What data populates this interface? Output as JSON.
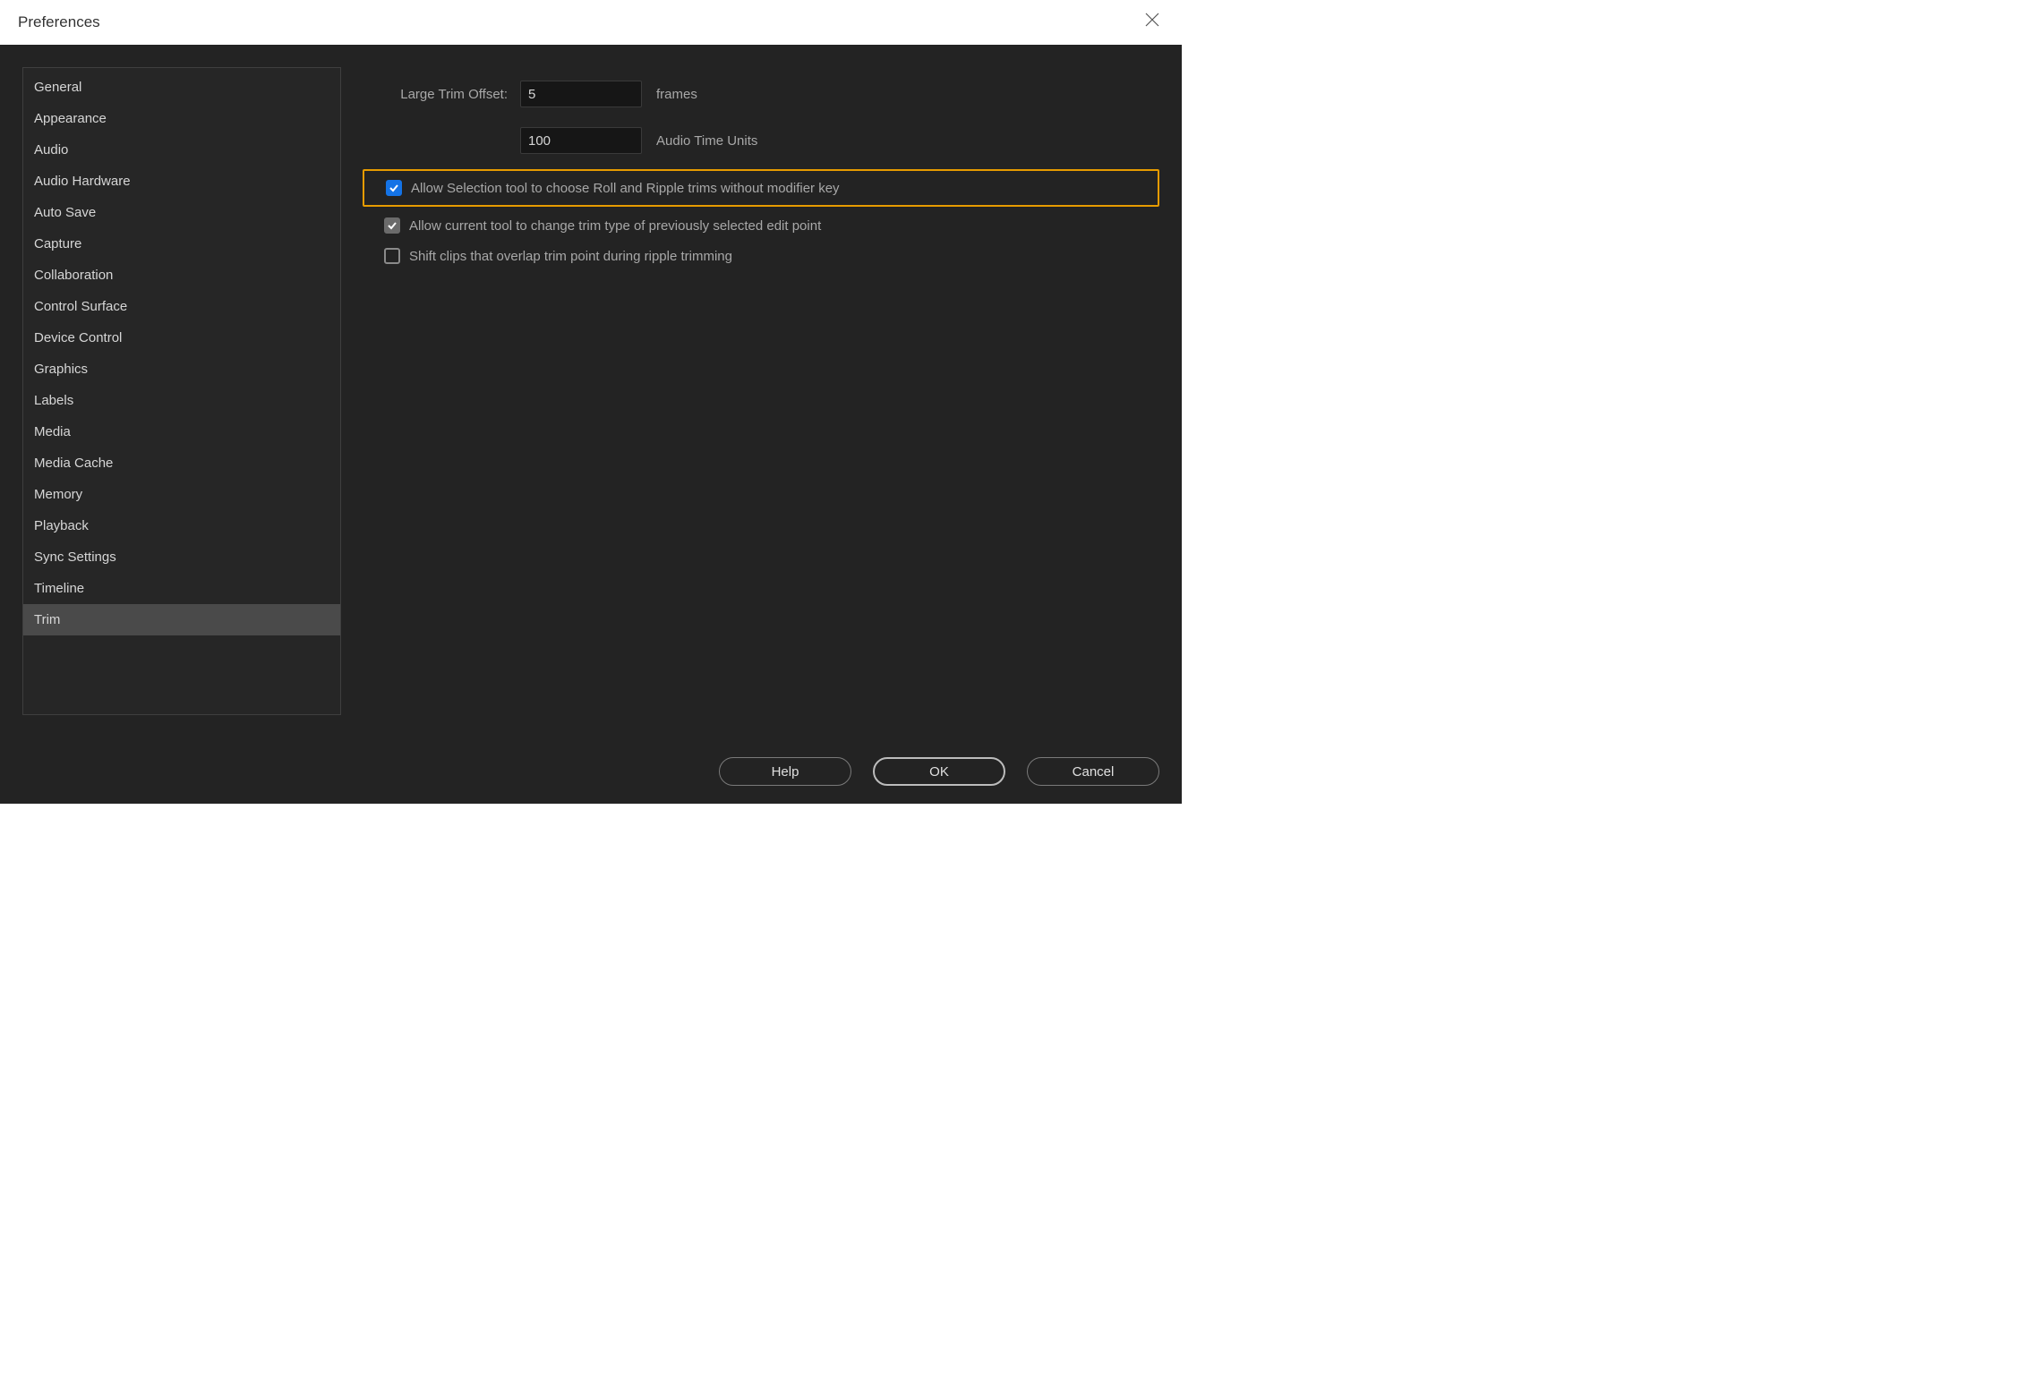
{
  "window": {
    "title": "Preferences"
  },
  "sidebar": {
    "items": [
      {
        "label": "General"
      },
      {
        "label": "Appearance"
      },
      {
        "label": "Audio"
      },
      {
        "label": "Audio Hardware"
      },
      {
        "label": "Auto Save"
      },
      {
        "label": "Capture"
      },
      {
        "label": "Collaboration"
      },
      {
        "label": "Control Surface"
      },
      {
        "label": "Device Control"
      },
      {
        "label": "Graphics"
      },
      {
        "label": "Labels"
      },
      {
        "label": "Media"
      },
      {
        "label": "Media Cache"
      },
      {
        "label": "Memory"
      },
      {
        "label": "Playback"
      },
      {
        "label": "Sync Settings"
      },
      {
        "label": "Timeline"
      },
      {
        "label": "Trim"
      }
    ],
    "selected_index": 17
  },
  "content": {
    "large_trim_offset": {
      "label": "Large Trim Offset:",
      "frames_value": "5",
      "frames_suffix": "frames",
      "audio_value": "100",
      "audio_suffix": "Audio Time Units"
    },
    "checkboxes": {
      "allow_selection": {
        "label": "Allow Selection tool to choose Roll and Ripple trims without modifier key",
        "checked": true,
        "highlighted": true
      },
      "allow_current_tool": {
        "label": "Allow current tool to change trim type of previously selected edit point",
        "checked": true,
        "highlighted": false
      },
      "shift_clips": {
        "label": "Shift clips that overlap trim point during ripple trimming",
        "checked": false,
        "highlighted": false
      }
    }
  },
  "buttons": {
    "help": "Help",
    "ok": "OK",
    "cancel": "Cancel"
  }
}
